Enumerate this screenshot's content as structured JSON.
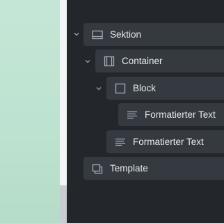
{
  "navigator": {
    "items": [
      {
        "label": "Sektion",
        "icon": "section-icon",
        "expanded": true
      },
      {
        "label": "Container",
        "icon": "container-icon",
        "expanded": true
      },
      {
        "label": "Block",
        "icon": "block-icon",
        "expanded": true
      },
      {
        "label": "Formatierter Text",
        "icon": "rich-text-icon"
      },
      {
        "label": "Formatierter Text",
        "icon": "rich-text-icon"
      },
      {
        "label": "Template",
        "icon": "template-icon"
      }
    ]
  },
  "colors": {
    "panel_bg": "#23272c",
    "row_bg": "#343a40",
    "text": "#e8eaed",
    "icon": "#a9afb6",
    "canvas": "#c1e4d3"
  }
}
